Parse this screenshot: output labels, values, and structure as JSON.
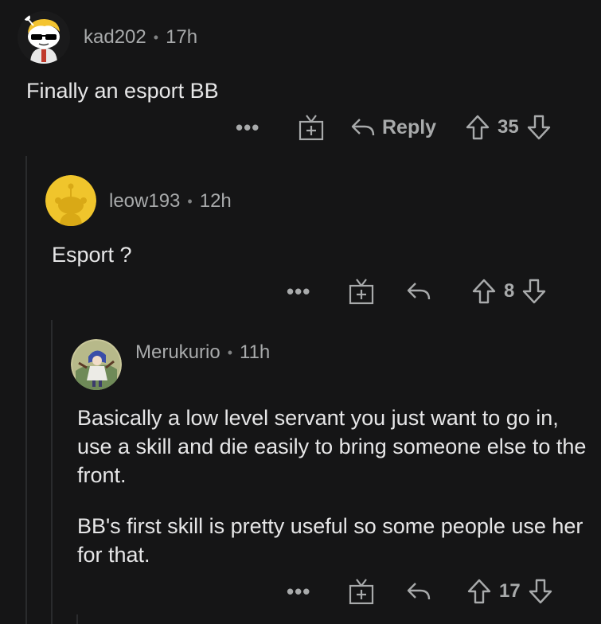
{
  "comments": [
    {
      "username": "kad202",
      "time": "17h",
      "body": [
        "Finally an esport BB"
      ],
      "reply_label": "Reply",
      "score": "35"
    },
    {
      "username": "leow193",
      "time": "12h",
      "body": [
        "Esport ?"
      ],
      "reply_label": "",
      "score": "8"
    },
    {
      "username": "Merukurio",
      "time": "11h",
      "body": [
        "Basically a low level servant you just want to go in, use a skill and die easily to bring someone else to the front.",
        "BB's first skill is pretty useful so some people use her for that."
      ],
      "reply_label": "",
      "score": "17"
    }
  ],
  "separator": "•",
  "more_glyph": "•••",
  "colors": {
    "background": "#151516",
    "text": "#e6e6e7",
    "muted": "#a8aaab",
    "thread_line": "#2a2b2d",
    "snoo_yellow": "#f0c52c"
  },
  "icons": {
    "more": "more-options-icon",
    "award": "award-gift-icon",
    "reply": "reply-arrow-icon",
    "upvote": "upvote-arrow-icon",
    "downvote": "downvote-arrow-icon"
  }
}
